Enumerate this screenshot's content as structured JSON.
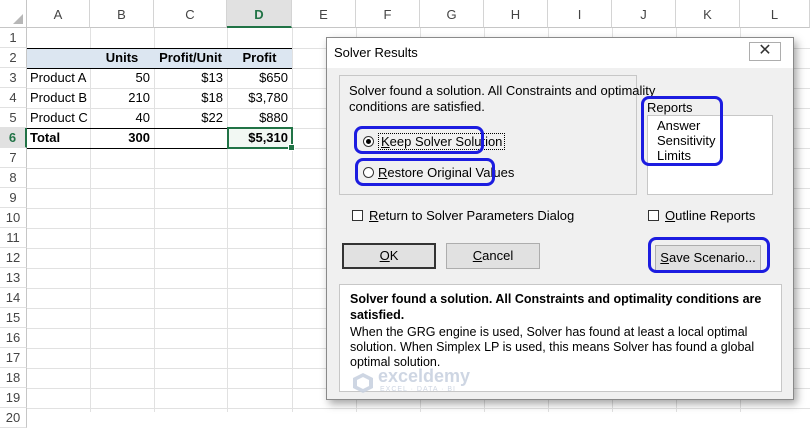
{
  "sheet": {
    "columns": [
      "A",
      "B",
      "C",
      "D",
      "E",
      "F",
      "G",
      "H",
      "I",
      "J",
      "K",
      "L"
    ],
    "rows": [
      "1",
      "2",
      "3",
      "4",
      "5",
      "6",
      "7",
      "8",
      "9",
      "10",
      "11",
      "12",
      "13",
      "14",
      "15",
      "16",
      "17",
      "18",
      "19",
      "20"
    ],
    "headers": {
      "units": "Units",
      "profit_unit": "Profit/Unit",
      "profit": "Profit"
    },
    "data": [
      {
        "product": "Product A",
        "units": "50",
        "profit_unit": "$13",
        "profit": "$650"
      },
      {
        "product": "Product B",
        "units": "210",
        "profit_unit": "$18",
        "profit": "$3,780"
      },
      {
        "product": "Product C",
        "units": "40",
        "profit_unit": "$22",
        "profit": "$880"
      }
    ],
    "total": {
      "label": "Total",
      "units": "300",
      "profit": "$5,310"
    },
    "selected_column": "D",
    "selected_row": "6"
  },
  "dialog": {
    "title": "Solver Results",
    "close_glyph": "✕",
    "message": "Solver found a solution.  All Constraints and optimality conditions are satisfied.",
    "keep": {
      "access_key": "K",
      "rest": "eep Solver Solution"
    },
    "restore": {
      "access_key": "R",
      "rest": "estore Original Values"
    },
    "reports_label": "Reports",
    "reports": [
      "Answer",
      "Sensitivity",
      "Limits"
    ],
    "return_check": {
      "access_key": "R",
      "rest": "eturn to Solver Parameters Dialog"
    },
    "outline_check": {
      "access_key": "O",
      "rest": "utline Reports"
    },
    "ok": {
      "access_key": "O",
      "rest": "K"
    },
    "cancel": {
      "access_key": "C",
      "rest": "ancel"
    },
    "save": {
      "access_key": "S",
      "rest": "ave Scenario..."
    },
    "info_title": "Solver found a solution.  All Constraints and optimality conditions are satisfied.",
    "info_body": "When the GRG engine is used, Solver has found at least a local optimal solution. When Simplex LP is used, this means Solver has found a global optimal solution.",
    "watermark": {
      "name": "exceldemy",
      "sub": "EXCEL · DATA · BI"
    },
    "highlight_color": "#1c1ce0"
  }
}
